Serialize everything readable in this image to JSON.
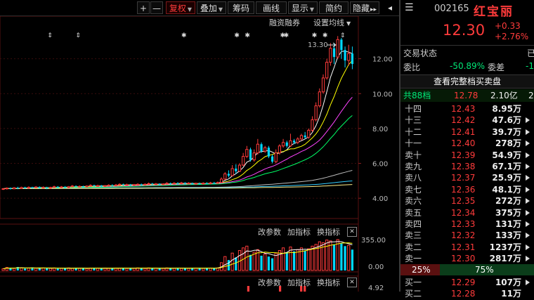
{
  "toolbar": {
    "plus": "+",
    "minus": "—",
    "fuquan": "复权",
    "diejia": "叠加",
    "choumai": "筹码",
    "huaxian": "画线",
    "xianshi": "显示",
    "jianyue": "简约",
    "yincang": "隐藏",
    "next": "▸▸",
    "collapse": "◂"
  },
  "chart": {
    "rzrq": "融资融券",
    "settings": "设置均线",
    "high_label": "13.30",
    "price_axis": [
      "12.00",
      "10.00",
      "8.00",
      "6.00",
      "4.00"
    ],
    "vol_axis": [
      "355.00",
      "0.00"
    ],
    "bottom_axis": "4.92",
    "sub1": {
      "params": "改参数",
      "add": "加指标",
      "swap": "换指标",
      "close": "✕"
    },
    "sub2": {
      "params": "改参数",
      "add": "加指标",
      "swap": "换指标",
      "close": "✕"
    }
  },
  "chart_data": {
    "type": "candlestick",
    "ylim": [
      3.0,
      14.2
    ],
    "high_marker": 13.3,
    "candles": [
      [
        4.52,
        4.55,
        4.48,
        4.58
      ],
      [
        4.55,
        4.58,
        4.5,
        4.62
      ],
      [
        4.58,
        4.54,
        4.5,
        4.62
      ],
      [
        4.54,
        4.6,
        4.52,
        4.64
      ],
      [
        4.6,
        4.56,
        4.52,
        4.66
      ],
      [
        4.56,
        4.62,
        4.54,
        4.66
      ],
      [
        4.62,
        4.58,
        4.54,
        4.66
      ],
      [
        4.58,
        4.63,
        4.55,
        4.68
      ],
      [
        4.63,
        4.6,
        4.56,
        4.66
      ],
      [
        4.6,
        4.64,
        4.58,
        4.7
      ],
      [
        4.64,
        4.6,
        4.55,
        4.68
      ],
      [
        4.6,
        4.62,
        4.56,
        4.68
      ],
      [
        4.62,
        4.58,
        4.52,
        4.66
      ],
      [
        4.58,
        4.62,
        4.54,
        4.66
      ],
      [
        4.62,
        4.66,
        4.58,
        4.72
      ],
      [
        4.66,
        4.62,
        4.58,
        4.7
      ],
      [
        4.62,
        4.65,
        4.58,
        4.7
      ],
      [
        4.65,
        4.61,
        4.56,
        4.7
      ],
      [
        4.61,
        4.66,
        4.58,
        4.7
      ],
      [
        4.66,
        4.7,
        4.62,
        4.76
      ],
      [
        4.7,
        4.66,
        4.62,
        4.74
      ],
      [
        4.66,
        4.68,
        4.62,
        4.74
      ],
      [
        4.68,
        4.65,
        4.6,
        4.72
      ],
      [
        4.65,
        4.7,
        4.62,
        4.74
      ],
      [
        4.7,
        4.74,
        4.66,
        4.8
      ],
      [
        4.74,
        4.7,
        4.66,
        4.78
      ],
      [
        4.7,
        4.72,
        4.66,
        4.78
      ],
      [
        4.72,
        4.68,
        4.64,
        4.76
      ],
      [
        4.68,
        4.72,
        4.64,
        4.76
      ],
      [
        4.72,
        4.75,
        4.68,
        4.8
      ],
      [
        4.75,
        4.72,
        4.68,
        4.8
      ],
      [
        4.72,
        4.76,
        4.7,
        4.82
      ],
      [
        4.76,
        4.8,
        4.72,
        4.86
      ],
      [
        4.8,
        4.76,
        4.72,
        4.84
      ],
      [
        4.76,
        4.78,
        4.72,
        4.84
      ],
      [
        4.78,
        4.74,
        4.7,
        4.82
      ],
      [
        4.74,
        4.78,
        4.7,
        4.82
      ],
      [
        4.78,
        4.8,
        4.74,
        4.86
      ],
      [
        4.8,
        4.76,
        4.72,
        4.84
      ],
      [
        4.76,
        4.8,
        4.72,
        4.86
      ],
      [
        4.8,
        4.84,
        4.76,
        4.9
      ],
      [
        4.84,
        4.8,
        4.76,
        4.88
      ],
      [
        4.8,
        4.82,
        4.76,
        4.88
      ],
      [
        4.82,
        4.78,
        4.74,
        4.86
      ],
      [
        4.78,
        4.82,
        4.74,
        4.86
      ],
      [
        4.82,
        4.86,
        4.78,
        4.92
      ],
      [
        4.86,
        4.82,
        4.78,
        4.9
      ],
      [
        4.82,
        4.86,
        4.78,
        4.92
      ],
      [
        4.86,
        4.84,
        4.8,
        4.92
      ],
      [
        4.84,
        4.88,
        4.8,
        4.94
      ],
      [
        4.88,
        4.84,
        4.8,
        4.92
      ],
      [
        4.84,
        4.86,
        4.8,
        4.92
      ],
      [
        4.86,
        4.82,
        4.78,
        4.9
      ],
      [
        4.82,
        4.85,
        4.78,
        4.9
      ],
      [
        4.85,
        4.82,
        4.78,
        4.9
      ],
      [
        4.82,
        4.86,
        4.78,
        4.92
      ],
      [
        4.86,
        4.84,
        4.8,
        4.92
      ],
      [
        4.84,
        4.88,
        4.8,
        4.94
      ],
      [
        4.88,
        4.86,
        4.82,
        4.94
      ],
      [
        4.86,
        4.9,
        4.82,
        4.96
      ],
      [
        4.9,
        5.1,
        4.88,
        5.2
      ],
      [
        5.1,
        5.4,
        5.05,
        5.5
      ],
      [
        5.4,
        5.3,
        5.2,
        5.6
      ],
      [
        5.3,
        5.7,
        5.25,
        5.9
      ],
      [
        5.7,
        5.55,
        5.4,
        5.95
      ],
      [
        5.55,
        5.9,
        5.5,
        6.0
      ],
      [
        5.9,
        6.4,
        5.85,
        6.6
      ],
      [
        6.4,
        6.8,
        6.3,
        7.0
      ],
      [
        6.8,
        6.2,
        6.1,
        6.9
      ],
      [
        6.2,
        6.6,
        6.1,
        6.8
      ],
      [
        6.6,
        7.1,
        6.5,
        7.4
      ],
      [
        7.1,
        6.7,
        6.6,
        7.2
      ],
      [
        6.7,
        6.9,
        6.6,
        7.0
      ],
      [
        6.9,
        6.4,
        6.3,
        7.0
      ],
      [
        6.4,
        6.1,
        6.0,
        6.5
      ],
      [
        6.1,
        6.6,
        6.0,
        6.8
      ],
      [
        6.6,
        7.0,
        6.5,
        7.1
      ],
      [
        7.0,
        7.2,
        6.9,
        7.4
      ],
      [
        7.2,
        7.0,
        6.9,
        7.3
      ],
      [
        7.0,
        7.3,
        6.95,
        7.7
      ],
      [
        7.3,
        7.2,
        7.1,
        7.4
      ],
      [
        7.2,
        7.4,
        7.1,
        7.5
      ],
      [
        7.4,
        7.6,
        7.3,
        7.7
      ],
      [
        7.6,
        7.5,
        7.4,
        7.8
      ],
      [
        7.5,
        7.9,
        7.4,
        8.0
      ],
      [
        7.9,
        8.5,
        7.8,
        8.7
      ],
      [
        8.5,
        9.3,
        8.4,
        9.5
      ],
      [
        9.3,
        10.1,
        9.2,
        10.3
      ],
      [
        10.1,
        10.9,
        10.0,
        11.1
      ],
      [
        10.9,
        11.8,
        10.8,
        12.0
      ],
      [
        11.8,
        12.6,
        11.6,
        12.9
      ],
      [
        12.6,
        12.1,
        11.7,
        12.9
      ],
      [
        12.1,
        13.1,
        12.0,
        13.3
      ],
      [
        13.1,
        12.5,
        12.0,
        13.2
      ],
      [
        12.5,
        11.9,
        11.5,
        12.7
      ],
      [
        11.9,
        12.3,
        11.6,
        12.8
      ],
      [
        12.3,
        11.7,
        11.4,
        12.7
      ]
    ],
    "volumes": [
      20,
      35,
      30,
      25,
      40,
      30,
      22,
      28,
      35,
      26,
      24,
      30,
      28,
      26,
      30,
      22,
      26,
      28,
      30,
      24,
      28,
      26,
      30,
      22,
      28,
      30,
      26,
      24,
      28,
      26,
      30,
      28,
      26,
      30,
      24,
      28,
      26,
      30,
      28,
      24,
      30,
      26,
      28,
      24,
      26,
      30,
      28,
      26,
      30,
      24,
      28,
      26,
      30,
      28,
      24,
      26,
      30,
      28,
      26,
      30,
      90,
      160,
      120,
      200,
      150,
      230,
      260,
      280,
      180,
      210,
      240,
      170,
      190,
      160,
      140,
      200,
      230,
      260,
      210,
      270,
      220,
      240,
      260,
      230,
      250,
      280,
      300,
      330,
      320,
      350,
      340,
      300,
      355,
      310,
      280,
      290,
      240
    ]
  },
  "quote": {
    "code": "002165",
    "name": "红宝丽",
    "price": "12.30",
    "change": "+0.33",
    "change_pct": "+2.76%",
    "status_label": "交易状态",
    "status_value": "已",
    "weibi_label": "委比",
    "weibi_value": "-50.89%",
    "weicha_label": "委差",
    "weicha_value": "-1",
    "full_book": "查看完整档买卖盘",
    "total_label": "共88档",
    "total_price": "12.78",
    "total_amount": "2.10亿",
    "total_extra": "2",
    "sell": [
      {
        "lvl": "十四",
        "px": "12.43",
        "vol": "8.95万"
      },
      {
        "lvl": "十三",
        "px": "12.42",
        "vol": "47.6万"
      },
      {
        "lvl": "十二",
        "px": "12.41",
        "vol": "39.7万"
      },
      {
        "lvl": "十一",
        "px": "12.40",
        "vol": "278万"
      },
      {
        "lvl": "卖十",
        "px": "12.39",
        "vol": "54.9万"
      },
      {
        "lvl": "卖九",
        "px": "12.38",
        "vol": "67.1万"
      },
      {
        "lvl": "卖八",
        "px": "12.37",
        "vol": "25.9万"
      },
      {
        "lvl": "卖七",
        "px": "12.36",
        "vol": "48.1万"
      },
      {
        "lvl": "卖六",
        "px": "12.35",
        "vol": "272万"
      },
      {
        "lvl": "卖五",
        "px": "12.34",
        "vol": "375万"
      },
      {
        "lvl": "卖四",
        "px": "12.33",
        "vol": "131万"
      },
      {
        "lvl": "卖三",
        "px": "12.32",
        "vol": "133万"
      },
      {
        "lvl": "卖二",
        "px": "12.31",
        "vol": "1237万"
      },
      {
        "lvl": "卖一",
        "px": "12.30",
        "vol": "2817万"
      }
    ],
    "ratio_sell": "25%",
    "ratio_buy": "75%",
    "buy1": {
      "lvl": "买一",
      "px": "12.29",
      "vol": "107万"
    },
    "buy2": {
      "lvl": "买二",
      "px": "12.28",
      "vol": "11万"
    },
    "colors": {
      "up": "#ff3b3b",
      "down": "#00d8ff",
      "bg": "#000000"
    }
  }
}
